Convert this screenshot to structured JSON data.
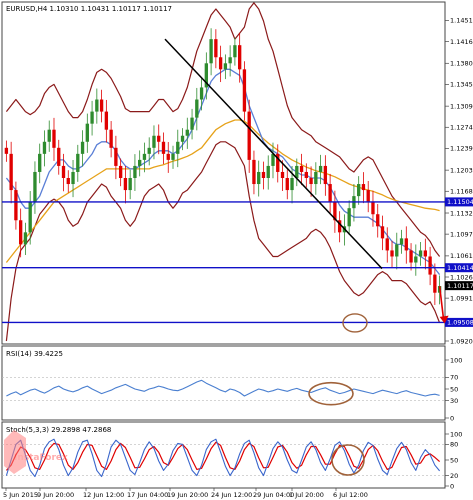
{
  "chart_data": [
    {
      "type": "candlestick",
      "panel": "main",
      "header": "EURUSD,H4  1.10310 1.10431 1.10117 1.10117",
      "ylim": [
        1.092,
        1.146
      ],
      "yticks": [
        "1.14510",
        "1.14160",
        "1.13800",
        "1.13450",
        "1.13090",
        "1.12740",
        "1.12390",
        "1.12030",
        "1.11680",
        "1.11320",
        "1.10970",
        "1.10610",
        "1.10260",
        "1.09910",
        "1.09200"
      ],
      "levels": [
        {
          "label": "1.11504",
          "value": 1.11504
        },
        {
          "label": "1.10414",
          "value": 1.10414
        },
        {
          "label": "1.09508",
          "value": 1.09508
        }
      ],
      "current_price": "1.10117",
      "price_path": [
        1.123,
        1.117,
        1.112,
        1.108,
        1.11,
        1.115,
        1.12,
        1.123,
        1.125,
        1.127,
        1.124,
        1.121,
        1.119,
        1.118,
        1.12,
        1.123,
        1.125,
        1.128,
        1.13,
        1.132,
        1.13,
        1.127,
        1.124,
        1.121,
        1.119,
        1.117,
        1.119,
        1.121,
        1.122,
        1.123,
        1.124,
        1.126,
        1.125,
        1.123,
        1.122,
        1.123,
        1.125,
        1.126,
        1.127,
        1.129,
        1.132,
        1.134,
        1.138,
        1.142,
        1.139,
        1.137,
        1.138,
        1.139,
        1.141,
        1.137,
        1.13,
        1.122,
        1.118,
        1.12,
        1.119,
        1.121,
        1.123,
        1.12,
        1.119,
        1.117,
        1.119,
        1.121,
        1.12,
        1.119,
        1.118,
        1.12,
        1.121,
        1.118,
        1.115,
        1.112,
        1.11,
        1.111,
        1.114,
        1.116,
        1.118,
        1.117,
        1.115,
        1.113,
        1.111,
        1.109,
        1.107,
        1.106,
        1.108,
        1.109,
        1.107,
        1.105,
        1.106,
        1.107,
        1.106,
        1.103,
        1.1,
        1.1011
      ],
      "upper_band": [
        1.13,
        1.131,
        1.132,
        1.131,
        1.13,
        1.1295,
        1.13,
        1.131,
        1.133,
        1.134,
        1.1345,
        1.133,
        1.1315,
        1.13,
        1.129,
        1.129,
        1.13,
        1.132,
        1.1345,
        1.1365,
        1.137,
        1.1365,
        1.1355,
        1.134,
        1.1325,
        1.1305,
        1.13,
        1.13,
        1.13,
        1.13,
        1.13,
        1.131,
        1.132,
        1.132,
        1.131,
        1.13,
        1.1305,
        1.132,
        1.134,
        1.137,
        1.14,
        1.142,
        1.144,
        1.146,
        1.147,
        1.146,
        1.145,
        1.144,
        1.142,
        1.143,
        1.144,
        1.147,
        1.148,
        1.147,
        1.145,
        1.142,
        1.14,
        1.137,
        1.134,
        1.131,
        1.129,
        1.128,
        1.127,
        1.1265,
        1.126,
        1.125,
        1.1245,
        1.124,
        1.1235,
        1.123,
        1.1225,
        1.1215,
        1.1205,
        1.12,
        1.121,
        1.122,
        1.1225,
        1.122,
        1.1205,
        1.119,
        1.1175,
        1.116,
        1.115,
        1.114,
        1.113,
        1.112,
        1.111,
        1.11,
        1.1095,
        1.1085,
        1.107,
        1.106
      ],
      "lower_band": [
        1.092,
        1.099,
        1.104,
        1.107,
        1.108,
        1.109,
        1.111,
        1.113,
        1.114,
        1.115,
        1.1155,
        1.115,
        1.114,
        1.112,
        1.111,
        1.1115,
        1.113,
        1.115,
        1.116,
        1.117,
        1.118,
        1.1175,
        1.116,
        1.115,
        1.114,
        1.112,
        1.111,
        1.112,
        1.114,
        1.116,
        1.117,
        1.1175,
        1.118,
        1.117,
        1.115,
        1.114,
        1.115,
        1.1165,
        1.117,
        1.118,
        1.119,
        1.12,
        1.1215,
        1.123,
        1.1245,
        1.125,
        1.125,
        1.1245,
        1.124,
        1.1225,
        1.121,
        1.116,
        1.112,
        1.109,
        1.108,
        1.107,
        1.106,
        1.106,
        1.1065,
        1.107,
        1.1075,
        1.108,
        1.1085,
        1.109,
        1.11,
        1.1105,
        1.11,
        1.109,
        1.1075,
        1.1055,
        1.1035,
        1.102,
        1.101,
        1.1,
        1.0995,
        1.1,
        1.101,
        1.102,
        1.103,
        1.1035,
        1.103,
        1.102,
        1.102,
        1.102,
        1.1015,
        1.1005,
        1.0995,
        1.0985,
        1.098,
        1.0985,
        1.097,
        1.095
      ],
      "ma_fast": [
        1.119,
        1.118,
        1.117,
        1.115,
        1.114,
        1.114,
        1.115,
        1.116,
        1.118,
        1.12,
        1.121,
        1.122,
        1.122,
        1.121,
        1.1205,
        1.1205,
        1.121,
        1.122,
        1.123,
        1.1245,
        1.125,
        1.125,
        1.1245,
        1.1235,
        1.122,
        1.121,
        1.1205,
        1.1205,
        1.121,
        1.1215,
        1.122,
        1.123,
        1.1235,
        1.1235,
        1.1235,
        1.123,
        1.1235,
        1.1245,
        1.1255,
        1.127,
        1.129,
        1.131,
        1.133,
        1.135,
        1.136,
        1.1365,
        1.137,
        1.137,
        1.1365,
        1.136,
        1.134,
        1.131,
        1.129,
        1.127,
        1.125,
        1.124,
        1.1235,
        1.123,
        1.1225,
        1.1215,
        1.1205,
        1.12,
        1.1195,
        1.1195,
        1.119,
        1.119,
        1.119,
        1.1185,
        1.1175,
        1.116,
        1.1145,
        1.1135,
        1.113,
        1.1125,
        1.1125,
        1.1125,
        1.1125,
        1.112,
        1.1115,
        1.1105,
        1.1095,
        1.1085,
        1.108,
        1.108,
        1.1075,
        1.107,
        1.1065,
        1.106,
        1.1055,
        1.105,
        1.104,
        1.103
      ],
      "ma_slow": [
        1.105,
        1.106,
        1.107,
        1.108,
        1.109,
        1.11,
        1.111,
        1.112,
        1.113,
        1.114,
        1.115,
        1.1155,
        1.116,
        1.1165,
        1.117,
        1.1175,
        1.118,
        1.1185,
        1.119,
        1.1195,
        1.12,
        1.1205,
        1.1205,
        1.1205,
        1.1205,
        1.1205,
        1.1205,
        1.1205,
        1.1205,
        1.1205,
        1.1205,
        1.1208,
        1.121,
        1.1212,
        1.1215,
        1.1218,
        1.122,
        1.1223,
        1.1226,
        1.123,
        1.1235,
        1.124,
        1.125,
        1.126,
        1.127,
        1.1275,
        1.128,
        1.1283,
        1.1286,
        1.1286,
        1.1284,
        1.1278,
        1.127,
        1.1262,
        1.1255,
        1.1248,
        1.1242,
        1.1236,
        1.123,
        1.1225,
        1.122,
        1.1216,
        1.1212,
        1.1208,
        1.1205,
        1.1202,
        1.12,
        1.1198,
        1.1195,
        1.1192,
        1.1188,
        1.1184,
        1.118,
        1.1177,
        1.1175,
        1.1172,
        1.117,
        1.1168,
        1.1165,
        1.1162,
        1.1158,
        1.1155,
        1.1152,
        1.115,
        1.1148,
        1.1146,
        1.1144,
        1.1142,
        1.114,
        1.1139,
        1.1138,
        1.1136
      ]
    },
    {
      "type": "line",
      "panel": "rsi",
      "header": "RSI(14) 39.4225",
      "ylim": [
        0,
        100
      ],
      "yticks": [
        "100",
        "70",
        "50",
        "30",
        "0"
      ],
      "values": [
        38,
        42,
        45,
        40,
        44,
        48,
        50,
        46,
        43,
        47,
        52,
        55,
        50,
        47,
        45,
        48,
        52,
        55,
        50,
        46,
        42,
        45,
        48,
        52,
        55,
        58,
        54,
        50,
        48,
        46,
        50,
        52,
        55,
        53,
        50,
        48,
        47,
        50,
        54,
        58,
        62,
        65,
        60,
        56,
        52,
        48,
        45,
        50,
        48,
        44,
        38,
        42,
        46,
        50,
        48,
        45,
        47,
        50,
        48,
        46,
        49,
        51,
        48,
        46,
        44,
        47,
        50,
        52,
        48,
        45,
        42,
        44,
        47,
        50,
        48,
        46,
        44,
        42,
        45,
        48,
        46,
        44,
        42,
        45,
        47,
        44,
        42,
        40,
        38,
        40,
        41,
        39
      ]
    },
    {
      "type": "line",
      "panel": "stochastic",
      "header": "Stoch(5,3,3) 29.2898 47.2868",
      "ylim": [
        0,
        100
      ],
      "yticks": [
        "100",
        "80",
        "50",
        "20",
        "0"
      ],
      "main_line": [
        20,
        50,
        80,
        88,
        60,
        30,
        18,
        40,
        72,
        85,
        90,
        70,
        40,
        20,
        35,
        65,
        85,
        88,
        62,
        30,
        18,
        42,
        75,
        88,
        80,
        55,
        30,
        22,
        45,
        70,
        85,
        72,
        48,
        30,
        42,
        68,
        82,
        80,
        55,
        30,
        20,
        40,
        70,
        85,
        90,
        65,
        38,
        20,
        35,
        62,
        82,
        88,
        64,
        35,
        20,
        45,
        72,
        85,
        75,
        50,
        30,
        25,
        50,
        75,
        85,
        70,
        45,
        30,
        52,
        78,
        85,
        68,
        42,
        25,
        40,
        68,
        84,
        78,
        52,
        30,
        22,
        48,
        72,
        84,
        70,
        45,
        30,
        55,
        70,
        60,
        40,
        29
      ],
      "signal_line": [
        30,
        40,
        60,
        75,
        70,
        55,
        35,
        32,
        50,
        72,
        82,
        80,
        62,
        40,
        32,
        45,
        65,
        80,
        78,
        58,
        38,
        32,
        48,
        70,
        82,
        74,
        55,
        35,
        36,
        52,
        70,
        76,
        65,
        45,
        40,
        55,
        72,
        80,
        70,
        50,
        32,
        34,
        52,
        72,
        84,
        78,
        55,
        35,
        32,
        48,
        70,
        82,
        76,
        54,
        35,
        36,
        55,
        75,
        78,
        65,
        45,
        34,
        40,
        60,
        76,
        76,
        60,
        42,
        42,
        62,
        78,
        76,
        58,
        38,
        34,
        50,
        70,
        78,
        68,
        48,
        32,
        36,
        56,
        74,
        76,
        60,
        42,
        44,
        58,
        62,
        55,
        47
      ]
    }
  ],
  "xticks": [
    "5 Jun 2015",
    "9 Jun 20:00",
    "12 Jun 12:00",
    "17 Jun 04:00",
    "19 Jun 20:00",
    "24 Jun 12:00",
    "29 Jun 04:00",
    "1 Jul 20:00",
    "6 Jul 12:00"
  ],
  "watermark": "InstaForex",
  "colors": {
    "bull": "#2e8b2e",
    "bear": "#e00000",
    "bands": "#8b1a1a",
    "ma_fast": "#5a7fd6",
    "ma_slow": "#e6a21a",
    "levels": "#1010c8",
    "trend": "#000000",
    "rsi": "#4a7fd0",
    "stoch_main": "#3a66cc",
    "stoch_signal": "#e00000",
    "annotation": "#a0623a"
  }
}
